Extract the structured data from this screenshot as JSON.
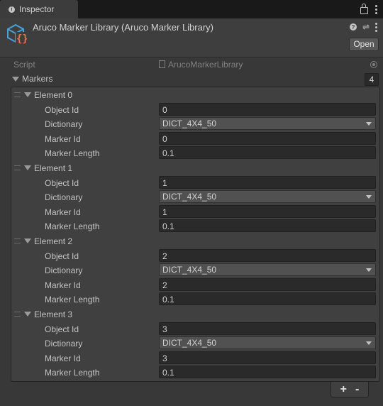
{
  "window": {
    "tab_label": "Inspector"
  },
  "header": {
    "title": "Aruco Marker Library (Aruco Marker Library)",
    "open_label": "Open"
  },
  "script_field": {
    "label": "Script",
    "value": "ArucoMarkerLibrary"
  },
  "markers": {
    "label": "Markers",
    "count": "4",
    "elements": [
      {
        "title": "Element 0",
        "object_id_label": "Object Id",
        "object_id": "0",
        "dictionary_label": "Dictionary",
        "dictionary": "DICT_4X4_50",
        "marker_id_label": "Marker Id",
        "marker_id": "0",
        "marker_length_label": "Marker Length",
        "marker_length": "0.1"
      },
      {
        "title": "Element 1",
        "object_id_label": "Object Id",
        "object_id": "1",
        "dictionary_label": "Dictionary",
        "dictionary": "DICT_4X4_50",
        "marker_id_label": "Marker Id",
        "marker_id": "1",
        "marker_length_label": "Marker Length",
        "marker_length": "0.1"
      },
      {
        "title": "Element 2",
        "object_id_label": "Object Id",
        "object_id": "2",
        "dictionary_label": "Dictionary",
        "dictionary": "DICT_4X4_50",
        "marker_id_label": "Marker Id",
        "marker_id": "2",
        "marker_length_label": "Marker Length",
        "marker_length": "0.1"
      },
      {
        "title": "Element 3",
        "object_id_label": "Object Id",
        "object_id": "3",
        "dictionary_label": "Dictionary",
        "dictionary": "DICT_4X4_50",
        "marker_id_label": "Marker Id",
        "marker_id": "3",
        "marker_length_label": "Marker Length",
        "marker_length": "0.1"
      }
    ]
  },
  "footer": {
    "add_label": "+",
    "remove_label": "-"
  },
  "icons": {
    "tab": "info-icon",
    "script": "script-icon",
    "header_actions": [
      "help-icon",
      "sliders-icon",
      "kebab-icon"
    ],
    "window_actions": [
      "lock-icon",
      "kebab-icon"
    ]
  },
  "colors": {
    "script_cube": "#4aa3d8",
    "script_braces": "#e8744f"
  }
}
